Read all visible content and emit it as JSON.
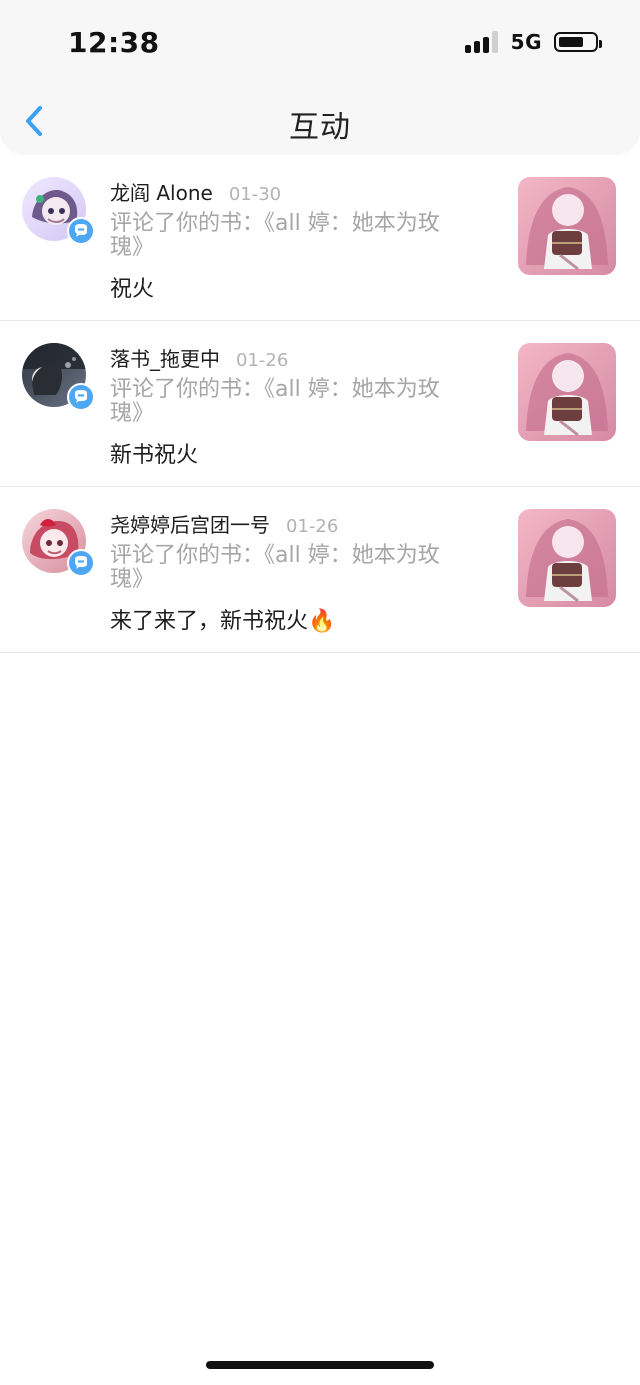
{
  "status_bar": {
    "time": "12:38",
    "network": "5G"
  },
  "header": {
    "title": "互动"
  },
  "interactions": [
    {
      "name": "龙阎 Alone",
      "date": "01-30",
      "description": "评论了你的书：《all 婷：她本为玫瑰》",
      "comment": "祝火"
    },
    {
      "name": "落书_拖更中",
      "date": "01-26",
      "description": "评论了你的书：《all 婷：她本为玫瑰》",
      "comment": "新书祝火"
    },
    {
      "name": "尧婷婷后宫团一号",
      "date": "01-26",
      "description": "评论了你的书：《all 婷：她本为玫瑰》",
      "comment": "来了来了，新书祝火🔥"
    }
  ],
  "icons": {
    "back": "chevron-left-icon",
    "comment_badge": "chat-bubble-icon",
    "status_signal": "signal-icon",
    "battery": "battery-icon"
  },
  "colors": {
    "accent_blue": "#4ea7f3",
    "text_primary": "#1e1e1e",
    "text_secondary": "#a6a6a6",
    "divider": "#e9e9e9",
    "header_bg": "#f7f7f7"
  }
}
